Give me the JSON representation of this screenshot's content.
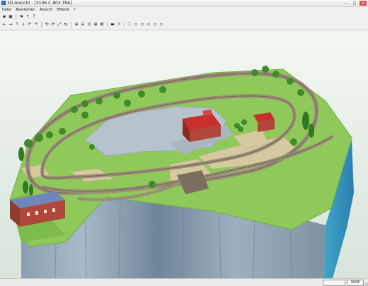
{
  "window": {
    "title": "3D-Ansicht - [3106 C 803.TRA]",
    "buttons": {
      "minimize": "–",
      "maximize": "□",
      "close": "×"
    }
  },
  "menu": [
    "Datei",
    "Bearbeiten",
    "Ansicht",
    "Effekte",
    "?"
  ],
  "toolbar": {
    "row1": [
      {
        "icon": "save-icon",
        "glyph": "▪"
      },
      {
        "icon": "print-icon",
        "glyph": "▣"
      },
      {
        "sep": true
      },
      {
        "icon": "hand-icon",
        "glyph": "☚"
      },
      {
        "icon": "arrow-up-icon",
        "glyph": "↑"
      },
      {
        "icon": "help-icon",
        "glyph": "?"
      }
    ],
    "row2": [
      {
        "icon": "arrow-left-icon",
        "glyph": "←"
      },
      {
        "icon": "arrow-right-icon",
        "glyph": "→"
      },
      {
        "icon": "arrow-up-icon",
        "glyph": "↑"
      },
      {
        "icon": "arrow-down-icon",
        "glyph": "↓"
      },
      {
        "icon": "rotate-left-icon",
        "glyph": "↶"
      },
      {
        "icon": "rotate-right-icon",
        "glyph": "↷"
      },
      {
        "sep": true
      },
      {
        "icon": "orbit-icon",
        "glyph": "⟲"
      },
      {
        "icon": "orbit-alt-icon",
        "glyph": "⟳"
      },
      {
        "icon": "tilt-icon",
        "glyph": "⤢"
      },
      {
        "icon": "walk-icon",
        "glyph": "⇆"
      },
      {
        "sep": true
      },
      {
        "icon": "zoom-in-icon",
        "glyph": "⊕"
      },
      {
        "icon": "zoom-out-icon",
        "glyph": "⊖"
      },
      {
        "icon": "zoom-window-icon",
        "glyph": "⊡"
      },
      {
        "icon": "zoom-fit-icon",
        "glyph": "⊞"
      },
      {
        "icon": "zoom-all-icon",
        "glyph": "⊠"
      },
      {
        "sep": true
      },
      {
        "icon": "train-icon",
        "glyph": "▬"
      },
      {
        "icon": "light-icon",
        "glyph": "☼"
      },
      {
        "sep": true
      },
      {
        "icon": "fullscreen-icon",
        "glyph": "⛶"
      },
      {
        "icon": "camera-1-icon",
        "glyph": "▫"
      },
      {
        "icon": "camera-2-icon",
        "glyph": "▫"
      },
      {
        "icon": "camera-3-icon",
        "glyph": "▫"
      },
      {
        "icon": "camera-4-icon",
        "glyph": "▫"
      },
      {
        "icon": "camera-5-icon",
        "glyph": "▫"
      }
    ]
  },
  "status": {
    "num": "NUM"
  },
  "colors": {
    "grass": "#8fc95a",
    "grass_dark": "#6fae43",
    "cliff": "#7f95a8",
    "cliff_light": "#a8bccb",
    "rock": "#cdbf96",
    "ballast": "#9a8e78",
    "rail": "#6b5a4a",
    "road": "#b7c3cc",
    "tree": "#3f8a2a",
    "roof_red": "#c8302b",
    "building_red": "#b0473a",
    "building_blue": "#6f86b8"
  }
}
